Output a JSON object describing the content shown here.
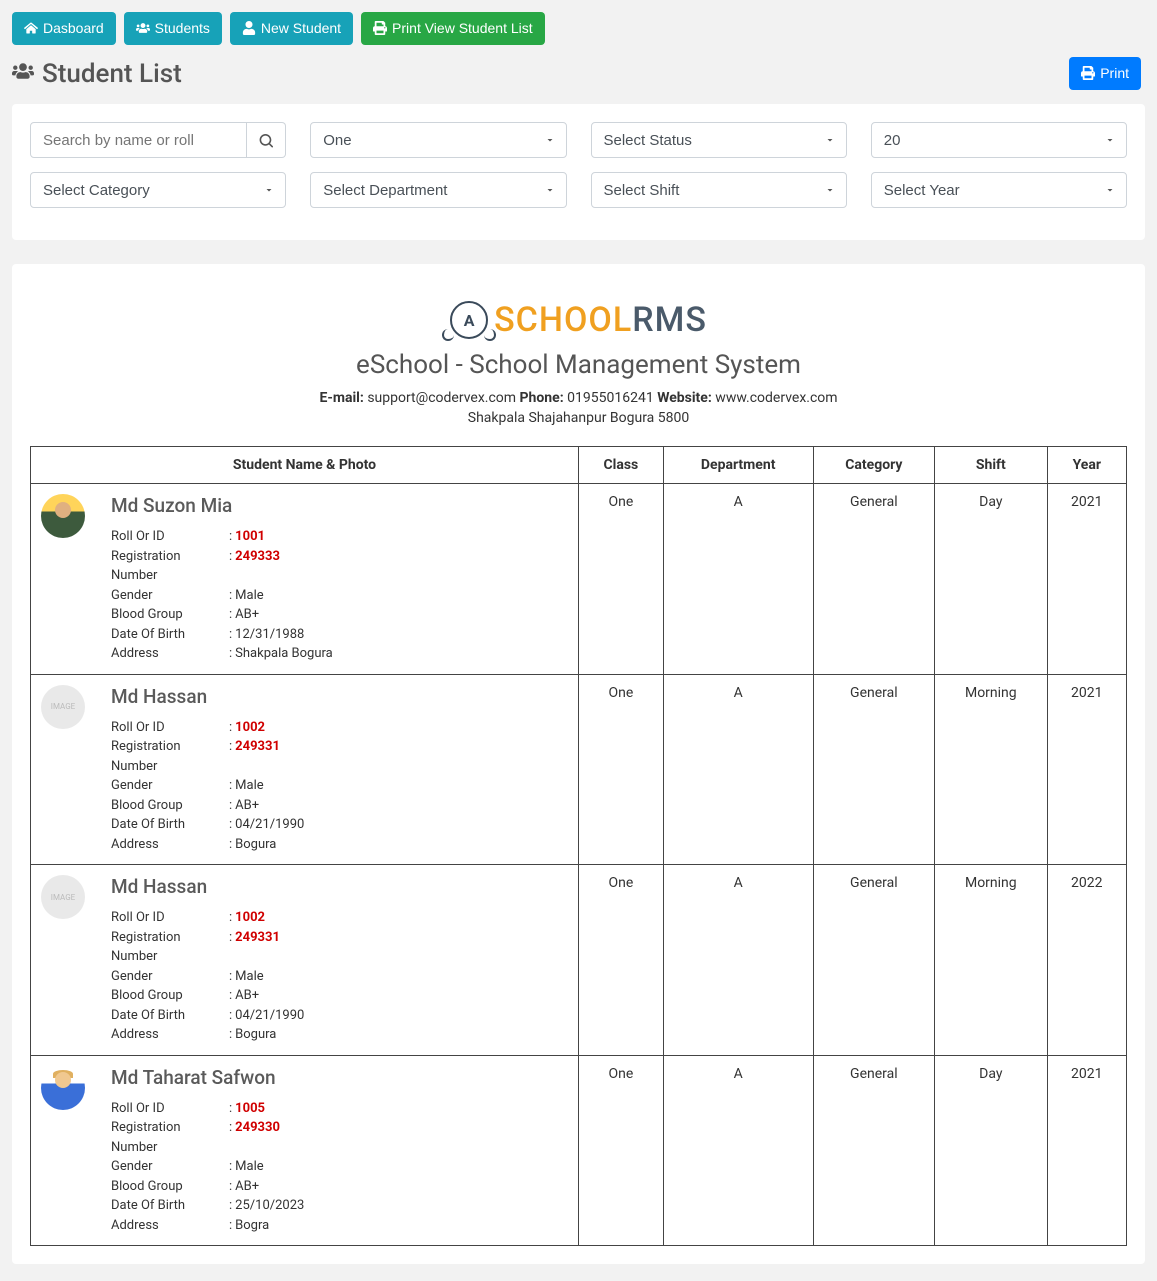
{
  "toolbar": {
    "dashboard": "Dasboard",
    "students": "Students",
    "new_student": "New Student",
    "print_view": "Print View Student List"
  },
  "page_title": "Student List",
  "print_btn": "Print",
  "filters": {
    "search_placeholder": "Search by name or roll",
    "class_selected": "One",
    "status_selected": "Select Status",
    "per_page_selected": "20",
    "category_selected": "Select Category",
    "department_selected": "Select Department",
    "shift_selected": "Select Shift",
    "year_selected": "Select Year"
  },
  "school": {
    "logo_text1": "SCHOOL",
    "logo_text2": "RMS",
    "name": "eSchool - School Management System",
    "email_label": "E-mail:",
    "email": "support@codervex.com",
    "phone_label": "Phone:",
    "phone": "01955016241",
    "website_label": "Website:",
    "website": "www.codervex.com",
    "address": "Shakpala Shajahanpur Bogura 5800"
  },
  "table": {
    "headers": {
      "name": "Student Name & Photo",
      "class": "Class",
      "department": "Department",
      "category": "Category",
      "shift": "Shift",
      "year": "Year"
    },
    "field_labels": {
      "roll": "Roll Or ID",
      "reg": "Registration Number",
      "gender": "Gender",
      "blood": "Blood Group",
      "dob": "Date Of Birth",
      "address": "Address"
    },
    "rows": [
      {
        "name": "Md Suzon Mia",
        "avatar": "person1",
        "roll": "1001",
        "reg": "249333",
        "gender": "Male",
        "blood": "AB+",
        "dob": "12/31/1988",
        "address": "Shakpala Bogura",
        "class": "One",
        "department": "A",
        "category": "General",
        "shift": "Day",
        "year": "2021"
      },
      {
        "name": "Md Hassan",
        "avatar": "placeholder",
        "roll": "1002",
        "reg": "249331",
        "gender": "Male",
        "blood": "AB+",
        "dob": "04/21/1990",
        "address": "Bogura",
        "class": "One",
        "department": "A",
        "category": "General",
        "shift": "Morning",
        "year": "2021"
      },
      {
        "name": "Md Hassan",
        "avatar": "placeholder",
        "roll": "1002",
        "reg": "249331",
        "gender": "Male",
        "blood": "AB+",
        "dob": "04/21/1990",
        "address": "Bogura",
        "class": "One",
        "department": "A",
        "category": "General",
        "shift": "Morning",
        "year": "2022"
      },
      {
        "name": "Md Taharat Safwon",
        "avatar": "person2",
        "roll": "1005",
        "reg": "249330",
        "gender": "Male",
        "blood": "AB+",
        "dob": "25/10/2023",
        "address": "Bogra",
        "class": "One",
        "department": "A",
        "category": "General",
        "shift": "Day",
        "year": "2021"
      }
    ]
  }
}
